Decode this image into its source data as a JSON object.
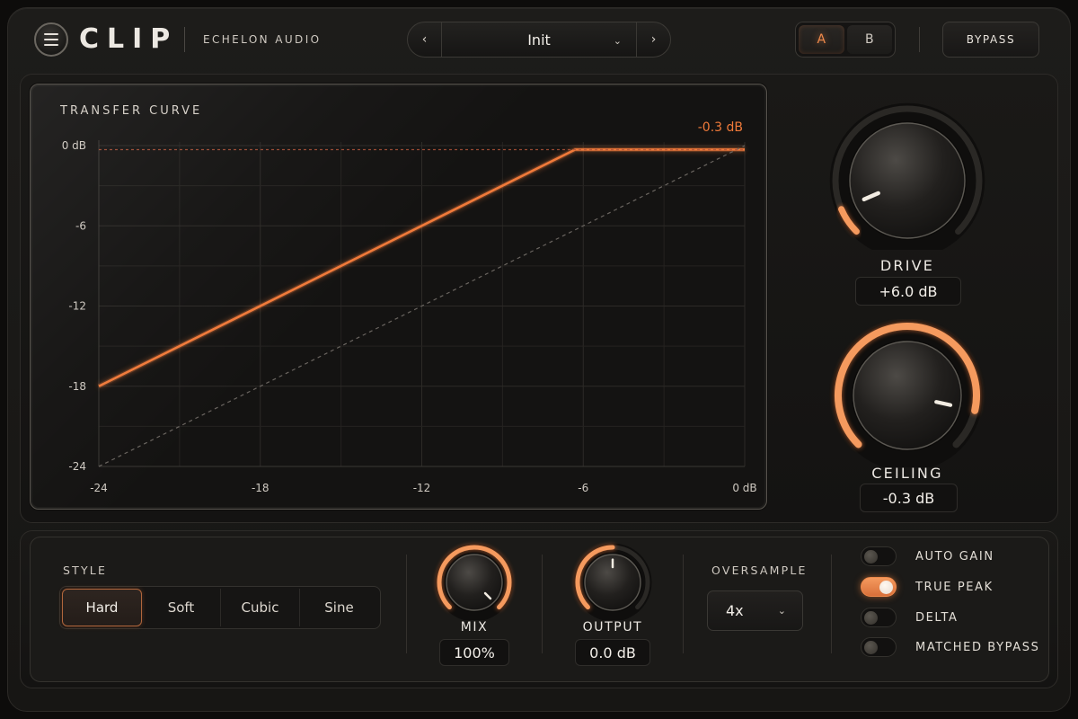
{
  "header": {
    "title": "CLIP",
    "brand": "ECHELON AUDIO",
    "preset": {
      "name": "Init",
      "prev_glyph": "‹",
      "next_glyph": "›",
      "chevron_glyph": "⌄"
    },
    "ab": {
      "a_label": "A",
      "b_label": "B",
      "active": "A"
    },
    "bypass_label": "BYPASS"
  },
  "graph": {
    "title": "TRANSFER CURVE",
    "ceiling_readout": "-0.3 dB",
    "y_ticks": [
      "0 dB",
      "-6",
      "-12",
      "-18",
      "-24"
    ],
    "x_ticks": [
      "-24",
      "-18",
      "-12",
      "-6",
      "0 dB"
    ]
  },
  "chart_data": {
    "type": "line",
    "title": "TRANSFER CURVE",
    "xlim": [
      -24,
      0
    ],
    "ylim": [
      -24,
      0
    ],
    "x_tick_labels": [
      "-24",
      "-18",
      "-12",
      "-6",
      "0 dB"
    ],
    "y_tick_labels": [
      "0 dB",
      "-6",
      "-12",
      "-18",
      "-24"
    ],
    "grid": true,
    "series": [
      {
        "role": "transfer",
        "color": "#f07a3a",
        "x": [
          -24,
          -6.3,
          0
        ],
        "y": [
          -18,
          -0.3,
          -0.3
        ]
      },
      {
        "role": "unity",
        "color": "#6a6560",
        "x": [
          -24,
          0
        ],
        "y": [
          -24,
          0
        ]
      },
      {
        "role": "ceiling",
        "color": "#b0553a",
        "x": [
          -24,
          0
        ],
        "y": [
          -0.3,
          -0.3
        ]
      }
    ],
    "annotation": "-0.3 dB"
  },
  "knobs": {
    "drive": {
      "label": "DRIVE",
      "value": "+6.0 dB",
      "fraction": 0.08
    },
    "ceiling": {
      "label": "CEILING",
      "value": "-0.3 dB",
      "fraction": 0.88
    },
    "mix": {
      "label": "MIX",
      "value": "100%",
      "fraction": 1.0
    },
    "output": {
      "label": "OUTPUT",
      "value": "0.0 dB",
      "fraction": 0.5
    }
  },
  "style": {
    "label": "STYLE",
    "options": [
      "Hard",
      "Soft",
      "Cubic",
      "Sine"
    ],
    "selected": "Hard"
  },
  "oversample": {
    "label": "OVERSAMPLE",
    "value": "4x",
    "chevron_glyph": "⌄"
  },
  "toggles": [
    {
      "label": "AUTO GAIN",
      "on": false
    },
    {
      "label": "TRUE PEAK",
      "on": true
    },
    {
      "label": "DELTA",
      "on": false
    },
    {
      "label": "MATCHED BYPASS",
      "on": false
    }
  ],
  "colors": {
    "accent": "#f07a3a",
    "accent_glow": "#f59a5e",
    "background": "#171614",
    "panel": "#141312",
    "text": "#e8e3dc"
  }
}
